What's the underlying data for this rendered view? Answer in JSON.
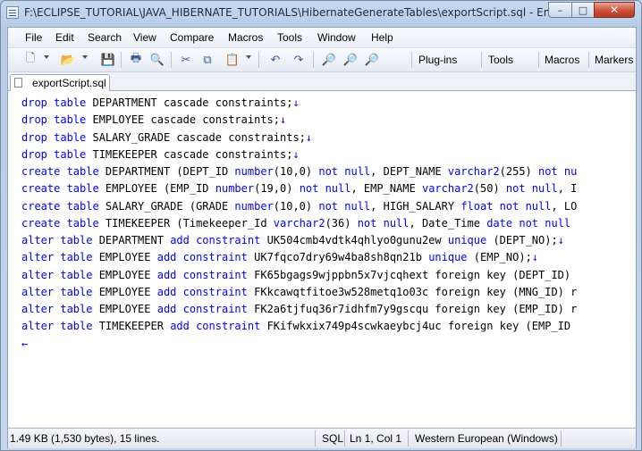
{
  "window": {
    "title": "F:\\ECLIPSE_TUTORIAL\\JAVA_HIBERNATE_TUTORIALS\\HibernateGenerateTables\\exportScript.sql - EmEditor",
    "controls": {
      "minimize": "–",
      "maximize": "□",
      "close": "✕"
    }
  },
  "menu": {
    "items": [
      {
        "label": "File"
      },
      {
        "label": "Edit"
      },
      {
        "label": "Search"
      },
      {
        "label": "View"
      },
      {
        "label": "Compare"
      },
      {
        "label": "Macros"
      },
      {
        "label": "Tools"
      },
      {
        "label": "Window"
      },
      {
        "label": "Help"
      }
    ]
  },
  "toolbar": {
    "icons": [
      {
        "name": "new-file-icon",
        "glyph": "🗋"
      },
      {
        "name": "open-folder-icon",
        "glyph": "📂"
      },
      {
        "name": "save-icon",
        "glyph": "💾"
      },
      {
        "name": "print-icon",
        "glyph": "🖶"
      },
      {
        "name": "print-preview-icon",
        "glyph": "🔍"
      },
      {
        "name": "cut-icon",
        "glyph": "✂"
      },
      {
        "name": "copy-icon",
        "glyph": "⧉"
      },
      {
        "name": "paste-icon",
        "glyph": "📋"
      },
      {
        "name": "undo-icon",
        "glyph": "↶"
      },
      {
        "name": "redo-icon",
        "glyph": "↷"
      },
      {
        "name": "find-icon",
        "glyph": "🔎"
      },
      {
        "name": "find-next-icon",
        "glyph": "🔎"
      },
      {
        "name": "find-previous-icon",
        "glyph": "🔎"
      }
    ],
    "plugins_label": "Plug-ins",
    "tools_label": "Tools",
    "macros_label": "Macros",
    "markers_label": "Markers"
  },
  "tab": {
    "label": "exportScript.sql"
  },
  "editor": {
    "keyword_color": "#0000ff",
    "eol_mark": "↓",
    "eof_mark": "←",
    "lines": [
      [
        {
          "t": "drop table",
          "k": true
        },
        {
          "t": " DEPARTMENT cascade constraints;",
          "k": false
        },
        {
          "t": "↓",
          "e": true
        }
      ],
      [
        {
          "t": "drop table",
          "k": true
        },
        {
          "t": " EMPLOYEE cascade constraints;",
          "k": false
        },
        {
          "t": "↓",
          "e": true
        }
      ],
      [
        {
          "t": "drop table",
          "k": true
        },
        {
          "t": " SALARY_GRADE cascade constraints;",
          "k": false
        },
        {
          "t": "↓",
          "e": true
        }
      ],
      [
        {
          "t": "drop table",
          "k": true
        },
        {
          "t": " TIMEKEEPER cascade constraints;",
          "k": false
        },
        {
          "t": "↓",
          "e": true
        }
      ],
      [
        {
          "t": "create table",
          "k": true
        },
        {
          "t": " DEPARTMENT (DEPT_ID ",
          "k": false
        },
        {
          "t": "number",
          "k": true
        },
        {
          "t": "(10,0) ",
          "k": false
        },
        {
          "t": "not null",
          "k": true
        },
        {
          "t": ", DEPT_NAME ",
          "k": false
        },
        {
          "t": "varchar2",
          "k": true
        },
        {
          "t": "(255) ",
          "k": false
        },
        {
          "t": "not nu",
          "k": true
        }
      ],
      [
        {
          "t": "create table",
          "k": true
        },
        {
          "t": " EMPLOYEE (EMP_ID ",
          "k": false
        },
        {
          "t": "number",
          "k": true
        },
        {
          "t": "(19,0) ",
          "k": false
        },
        {
          "t": "not null",
          "k": true
        },
        {
          "t": ", EMP_NAME ",
          "k": false
        },
        {
          "t": "varchar2",
          "k": true
        },
        {
          "t": "(50) ",
          "k": false
        },
        {
          "t": "not null",
          "k": true
        },
        {
          "t": ", I",
          "k": false
        }
      ],
      [
        {
          "t": "create table",
          "k": true
        },
        {
          "t": " SALARY_GRADE (GRADE ",
          "k": false
        },
        {
          "t": "number",
          "k": true
        },
        {
          "t": "(10,0) ",
          "k": false
        },
        {
          "t": "not null",
          "k": true
        },
        {
          "t": ", HIGH_SALARY ",
          "k": false
        },
        {
          "t": "float",
          "k": true
        },
        {
          "t": " ",
          "k": false
        },
        {
          "t": "not null",
          "k": true
        },
        {
          "t": ", LO",
          "k": false
        }
      ],
      [
        {
          "t": "create table",
          "k": true
        },
        {
          "t": " TIMEKEEPER (Timekeeper_Id ",
          "k": false
        },
        {
          "t": "varchar2",
          "k": true
        },
        {
          "t": "(36) ",
          "k": false
        },
        {
          "t": "not null",
          "k": true
        },
        {
          "t": ", Date_Time ",
          "k": false
        },
        {
          "t": "date",
          "k": true
        },
        {
          "t": " ",
          "k": false
        },
        {
          "t": "not null",
          "k": true
        }
      ],
      [
        {
          "t": "alter table",
          "k": true
        },
        {
          "t": " DEPARTMENT ",
          "k": false
        },
        {
          "t": "add constraint",
          "k": true
        },
        {
          "t": " UK504cmb4vdtk4qhlyo0gunu2ew ",
          "k": false
        },
        {
          "t": "unique",
          "k": true
        },
        {
          "t": " (DEPT_NO);",
          "k": false
        },
        {
          "t": "↓",
          "e": true
        }
      ],
      [
        {
          "t": "alter table",
          "k": true
        },
        {
          "t": " EMPLOYEE ",
          "k": false
        },
        {
          "t": "add constraint",
          "k": true
        },
        {
          "t": " UK7fqco7dry69w4ba8sh8qn21b ",
          "k": false
        },
        {
          "t": "unique",
          "k": true
        },
        {
          "t": " (EMP_NO);",
          "k": false
        },
        {
          "t": "↓",
          "e": true
        }
      ],
      [
        {
          "t": "alter table",
          "k": true
        },
        {
          "t": " EMPLOYEE ",
          "k": false
        },
        {
          "t": "add constraint",
          "k": true
        },
        {
          "t": " FK65bgags9wjppbn5x7vjcqhext foreign key (DEPT_ID)",
          "k": false
        }
      ],
      [
        {
          "t": "alter table",
          "k": true
        },
        {
          "t": " EMPLOYEE ",
          "k": false
        },
        {
          "t": "add constraint",
          "k": true
        },
        {
          "t": " FKkcawqtfitoe3w528metq1o03c foreign key (MNG_ID) r",
          "k": false
        }
      ],
      [
        {
          "t": "alter table",
          "k": true
        },
        {
          "t": " EMPLOYEE ",
          "k": false
        },
        {
          "t": "add constraint",
          "k": true
        },
        {
          "t": " FK2a6tjfuq36r7idhfm7y9gscqu foreign key (EMP_ID) r",
          "k": false
        }
      ],
      [
        {
          "t": "alter table",
          "k": true
        },
        {
          "t": " TIMEKEEPER ",
          "k": false
        },
        {
          "t": "add constraint",
          "k": true
        },
        {
          "t": " FKifwkxix749p4scwkaeybcj4uc foreign key (EMP_ID",
          "k": false
        }
      ],
      [
        {
          "t": "←",
          "e": true
        }
      ]
    ]
  },
  "status": {
    "file_info": "1.49 KB (1,530 bytes), 15 lines.",
    "mode": "SQL",
    "position": "Ln 1, Col 1",
    "encoding": "Western European (Windows)"
  }
}
